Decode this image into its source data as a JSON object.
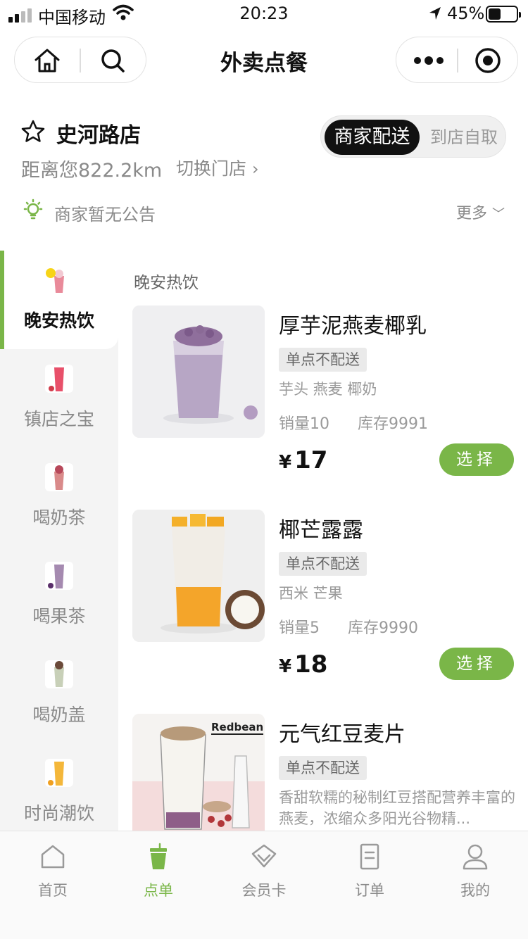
{
  "status_bar": {
    "carrier": "中国移动",
    "time": "20:23",
    "battery": "45%"
  },
  "nav": {
    "title": "外卖点餐"
  },
  "store": {
    "name": "史河路店",
    "distance": "距离您822.2km",
    "switch_label": "切换门店",
    "delivery_options": [
      "商家配送",
      "到店自取"
    ],
    "notice": "商家暂无公告",
    "more_label": "更多"
  },
  "categories": [
    {
      "label": "晚安热饮",
      "active": true
    },
    {
      "label": "镇店之宝",
      "active": false
    },
    {
      "label": "喝奶茶",
      "active": false
    },
    {
      "label": "喝果茶",
      "active": false
    },
    {
      "label": "喝奶盖",
      "active": false
    },
    {
      "label": "时尚潮饮",
      "active": false
    }
  ],
  "section_title": "晚安热饮",
  "products": [
    {
      "name": "厚芋泥燕麦椰乳",
      "tag": "单点不配送",
      "desc": "芋头 燕麦 椰奶",
      "sales": "销量10",
      "stock": "库存9991",
      "currency": "¥",
      "price": "17",
      "button": "选择"
    },
    {
      "name": "椰芒露露",
      "tag": "单点不配送",
      "desc": "西米 芒果",
      "sales": "销量5",
      "stock": "库存9990",
      "currency": "¥",
      "price": "18",
      "button": "选择"
    },
    {
      "name": "元气红豆麦片",
      "tag": "单点不配送",
      "desc": "香甜软糯的秘制红豆搭配营养丰富的燕麦，浓缩众多阳光谷物精...",
      "image_text": "Redbean"
    }
  ],
  "tabbar": [
    {
      "label": "首页",
      "icon": "home-icon"
    },
    {
      "label": "点单",
      "icon": "cup-icon",
      "active": true
    },
    {
      "label": "会员卡",
      "icon": "diamond-icon"
    },
    {
      "label": "订单",
      "icon": "receipt-icon"
    },
    {
      "label": "我的",
      "icon": "user-icon"
    }
  ],
  "colors": {
    "accent": "#7ab648",
    "dark": "#111111",
    "muted": "#8a8a8a"
  }
}
